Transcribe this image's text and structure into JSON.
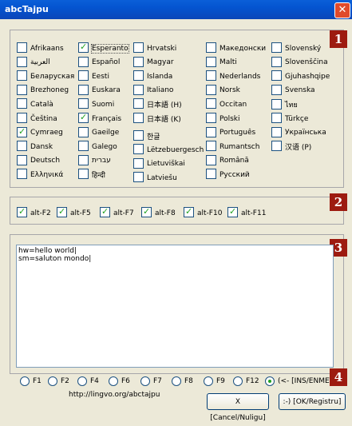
{
  "window": {
    "title": "abcTajpu"
  },
  "badges": [
    "1",
    "2",
    "3",
    "4"
  ],
  "languages": [
    [
      {
        "label": "Afrikaans",
        "checked": false
      },
      {
        "label": "العربية",
        "checked": false
      },
      {
        "label": "Беларуская",
        "checked": false
      },
      {
        "label": "Brezhoneg",
        "checked": false
      },
      {
        "label": "Català",
        "checked": false
      },
      {
        "label": "Čeština",
        "checked": false
      },
      {
        "label": "Cymraeg",
        "checked": true
      },
      {
        "label": "Dansk",
        "checked": false
      },
      {
        "label": "Deutsch",
        "checked": false
      },
      {
        "label": "Ελληνικά",
        "checked": false
      }
    ],
    [
      {
        "label": "Esperanto",
        "checked": true,
        "focus": true
      },
      {
        "label": "Español",
        "checked": false
      },
      {
        "label": "Eesti",
        "checked": false
      },
      {
        "label": "Euskara",
        "checked": false
      },
      {
        "label": "Suomi",
        "checked": false
      },
      {
        "label": "Français",
        "checked": true
      },
      {
        "label": "Gaeilge",
        "checked": false
      },
      {
        "label": "Galego",
        "checked": false
      },
      {
        "label": "עברית",
        "checked": false
      },
      {
        "label": "हिन्दी",
        "checked": false
      }
    ],
    [
      {
        "label": "Hrvatski",
        "checked": false
      },
      {
        "label": "Magyar",
        "checked": false
      },
      {
        "label": "Islanda",
        "checked": false
      },
      {
        "label": "Italiano",
        "checked": false
      },
      {
        "label": "日本語 (H)",
        "checked": false
      },
      {
        "label": "日本語 (K)",
        "checked": false
      },
      {
        "label": "한글",
        "checked": false
      },
      {
        "label": "Lëtzebuergesch",
        "checked": false
      },
      {
        "label": "Lietuviškai",
        "checked": false
      },
      {
        "label": "Latviešu",
        "checked": false
      }
    ],
    [
      {
        "label": "Македонски",
        "checked": false
      },
      {
        "label": "Malti",
        "checked": false
      },
      {
        "label": "Nederlands",
        "checked": false
      },
      {
        "label": "Norsk",
        "checked": false
      },
      {
        "label": "Occitan",
        "checked": false
      },
      {
        "label": "Polski",
        "checked": false
      },
      {
        "label": "Português",
        "checked": false
      },
      {
        "label": "Rumantsch",
        "checked": false
      },
      {
        "label": "Română",
        "checked": false
      },
      {
        "label": "Русский",
        "checked": false
      }
    ],
    [
      {
        "label": "Slovenský",
        "checked": false
      },
      {
        "label": "Slovenščina",
        "checked": false
      },
      {
        "label": "Gjuhashqipe",
        "checked": false
      },
      {
        "label": "Svenska",
        "checked": false
      },
      {
        "label": "ไทย",
        "checked": false
      },
      {
        "label": "Türkçe",
        "checked": false
      },
      {
        "label": "Українська",
        "checked": false
      },
      {
        "label": "汉语 (P)",
        "checked": false
      }
    ]
  ],
  "hotkeys": [
    {
      "label": "alt-F2",
      "checked": true
    },
    {
      "label": "alt-F5",
      "checked": true
    },
    {
      "label": "alt-F7",
      "checked": true
    },
    {
      "label": "alt-F8",
      "checked": true
    },
    {
      "label": "alt-F10",
      "checked": true
    },
    {
      "label": "alt-F11",
      "checked": true
    }
  ],
  "editor": {
    "text": "hw=hello world|\nsm=saluton mondo|"
  },
  "radios": [
    {
      "label": "F1",
      "selected": false
    },
    {
      "label": "F2",
      "selected": false
    },
    {
      "label": "F4",
      "selected": false
    },
    {
      "label": "F6",
      "selected": false
    },
    {
      "label": "F7",
      "selected": false
    },
    {
      "label": "F8",
      "selected": false
    },
    {
      "label": "F9",
      "selected": false
    },
    {
      "label": "F12",
      "selected": false
    },
    {
      "label": "(<- [INS/ENMETU]",
      "selected": true
    }
  ],
  "footer": {
    "url": "http://lingvo.org/abctajpu",
    "cancel_label": "X [Cancel/Nuligu]",
    "ok_label": ":-) [OK/Registru]"
  },
  "colors": {
    "titlebar": "#0454d0",
    "badge": "#9d1b10",
    "check": "#21a121",
    "face": "#ece9d8"
  },
  "icons": {
    "close": "close-icon"
  }
}
